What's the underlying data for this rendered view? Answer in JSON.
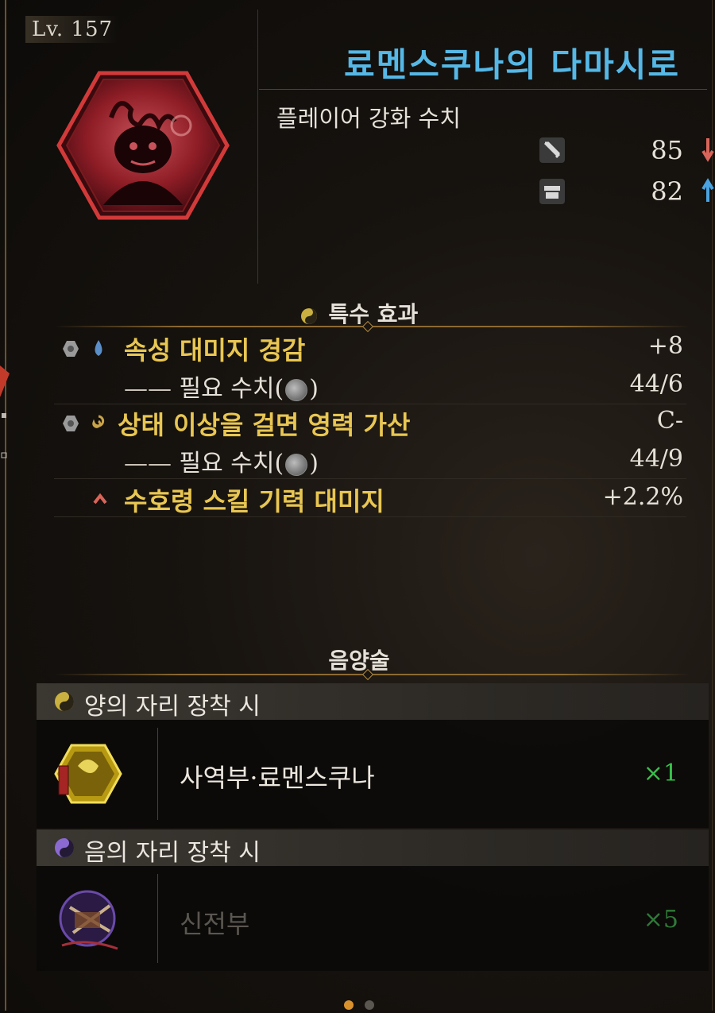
{
  "level": "Lv. 157",
  "item": {
    "name": "료멘스쿠나의 다마시로",
    "subtitle": "플레이어 강화 수치",
    "stats": [
      {
        "icon": "sword-icon",
        "value": "85",
        "trend": "down",
        "trend_color": "#d9655a"
      },
      {
        "icon": "armor-icon",
        "value": "82",
        "trend": "up",
        "trend_color": "#4aa3e0"
      }
    ]
  },
  "special": {
    "title": "특수 효과",
    "effects": [
      {
        "label": "속성 대미지 경감",
        "value": "+8",
        "req_label": "필요 수치(",
        "req_close": ")",
        "req_value": "44/6",
        "element": "water-drop-icon"
      },
      {
        "label": "상태 이상을 걸면 영력 가산",
        "value": "C-",
        "req_label": "필요 수치(",
        "req_close": ")",
        "req_value": "44/9",
        "element": "spirit-icon"
      }
    ],
    "bonus": {
      "label": "수호령 스킬 기력 대미지",
      "value": "+2.2%"
    }
  },
  "onmyo": {
    "title": "음양술",
    "yang": {
      "header": "양의 자리 장착 시",
      "item": "사역부·료멘스쿠나",
      "count": "×1"
    },
    "yin": {
      "header": "음의 자리 장착 시",
      "item": "신전부",
      "count": "×5"
    }
  },
  "colors": {
    "title": "#55b8e6",
    "effect_label": "#e8c652",
    "count": "#38c24a",
    "accent_gold": "#8c6a33"
  },
  "pager": {
    "pages": 2,
    "current": 1
  }
}
